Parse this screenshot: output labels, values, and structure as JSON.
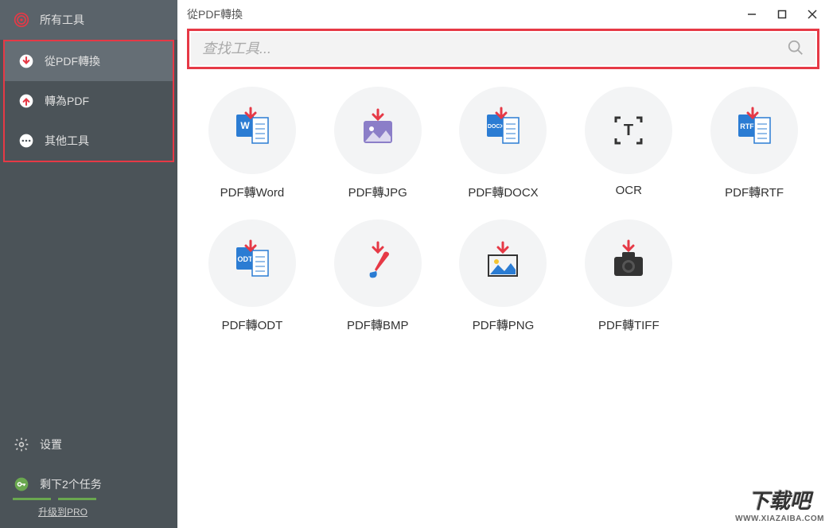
{
  "window": {
    "title": "從PDF轉換"
  },
  "sidebar": {
    "items": [
      {
        "label": "所有工具"
      },
      {
        "label": "從PDF轉換"
      },
      {
        "label": "轉為PDF"
      },
      {
        "label": "其他工具"
      }
    ],
    "settings_label": "设置",
    "tasks_label": "剩下2个任务",
    "upgrade_label": "升级到PRO"
  },
  "search": {
    "placeholder": "查找工具..."
  },
  "tools": [
    {
      "label": "PDF轉Word"
    },
    {
      "label": "PDF轉JPG"
    },
    {
      "label": "PDF轉DOCX"
    },
    {
      "label": "OCR"
    },
    {
      "label": "PDF轉RTF"
    },
    {
      "label": "PDF轉ODT"
    },
    {
      "label": "PDF轉BMP"
    },
    {
      "label": "PDF轉PNG"
    },
    {
      "label": "PDF轉TIFF"
    }
  ],
  "watermark": {
    "main": "下载吧",
    "sub": "WWW.XIAZAIBA.COM"
  }
}
